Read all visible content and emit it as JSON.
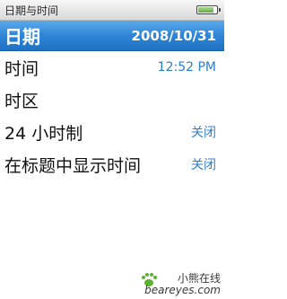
{
  "window": {
    "title": "日期与时间"
  },
  "status": {
    "battery_icon": "battery-icon",
    "battery_level": 0.85
  },
  "menu": {
    "items": [
      {
        "label": "日期",
        "value": "2008/10/31",
        "selected": true
      },
      {
        "label": "时间",
        "value": "12:52 PM",
        "selected": false
      },
      {
        "label": "时区",
        "value": "",
        "selected": false
      },
      {
        "label": "24 小时制",
        "value": "关闭",
        "selected": false
      },
      {
        "label": "在标题中显示时间",
        "value": "关闭",
        "selected": false
      }
    ]
  },
  "watermark": {
    "text_cn": "小熊在线",
    "text_en": "beareyes.com"
  },
  "colors": {
    "accent": "#2f86d6",
    "value_text": "#2b7ec9",
    "titlebar": "#e6e6e6"
  }
}
